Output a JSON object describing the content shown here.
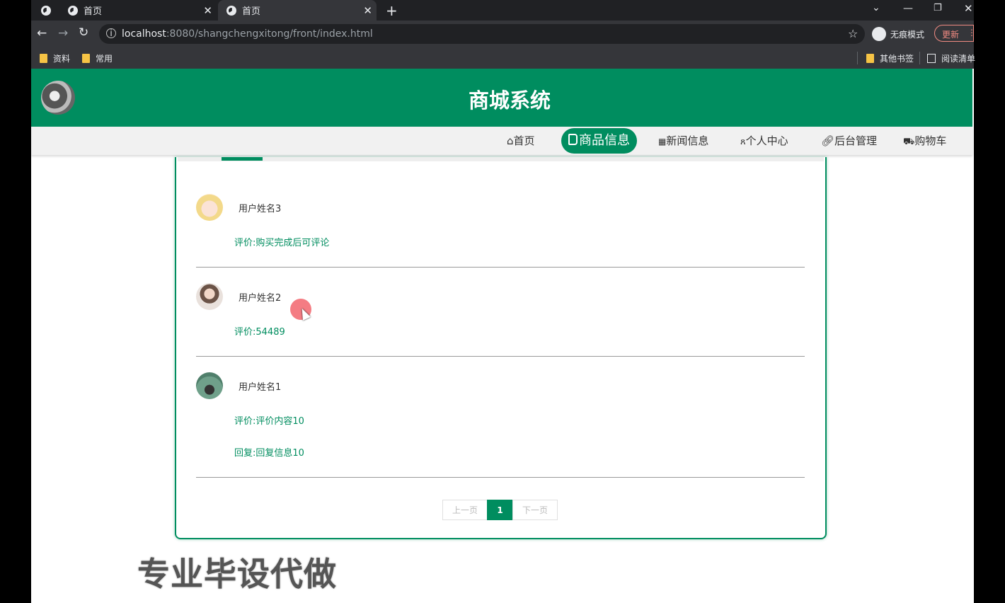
{
  "browser": {
    "tabs": [
      {
        "label": "首页"
      },
      {
        "label": "首页"
      }
    ],
    "url_host": "localhost",
    "url_rest": ":8080/shangchengxitong/front/index.html",
    "incognito_label": "无痕模式",
    "update_label": "更新",
    "bookmarks": [
      {
        "label": "资料"
      },
      {
        "label": "常用"
      }
    ],
    "other_bookmarks": "其他书签",
    "reading_list": "阅读清单"
  },
  "site": {
    "title": "商城系统",
    "brand_color": "#008d5f"
  },
  "nav": {
    "items": [
      {
        "icon": "home-icon",
        "label": "首页"
      },
      {
        "icon": "product-icon",
        "label": "商品信息",
        "active": true
      },
      {
        "icon": "news-icon",
        "label": "新闻信息"
      },
      {
        "icon": "user-icon",
        "label": "个人中心"
      },
      {
        "icon": "link-icon",
        "label": "后台管理"
      },
      {
        "icon": "cart-icon",
        "label": "购物车"
      }
    ]
  },
  "comments": [
    {
      "username": "用户姓名3",
      "comment": "评价:购买完成后可评论",
      "reply": null
    },
    {
      "username": "用户姓名2",
      "comment": "评价:54489",
      "reply": null
    },
    {
      "username": "用户姓名1",
      "comment": "评价:评价内容10",
      "reply": "回复:回复信息10"
    }
  ],
  "pagination": {
    "prev_label": "上一页",
    "current": "1",
    "next_label": "下一页"
  },
  "watermark": "专业毕设代做"
}
